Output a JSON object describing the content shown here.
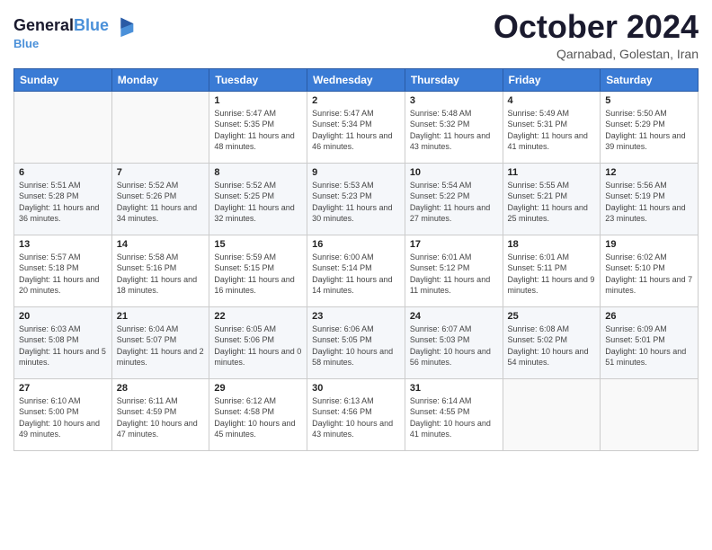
{
  "header": {
    "logo_line1": "General",
    "logo_line2": "Blue",
    "month_title": "October 2024",
    "location": "Qarnabad, Golestan, Iran"
  },
  "days_of_week": [
    "Sunday",
    "Monday",
    "Tuesday",
    "Wednesday",
    "Thursday",
    "Friday",
    "Saturday"
  ],
  "weeks": [
    [
      {
        "day": "",
        "sunrise": "",
        "sunset": "",
        "daylight": ""
      },
      {
        "day": "",
        "sunrise": "",
        "sunset": "",
        "daylight": ""
      },
      {
        "day": "1",
        "sunrise": "Sunrise: 5:47 AM",
        "sunset": "Sunset: 5:35 PM",
        "daylight": "Daylight: 11 hours and 48 minutes."
      },
      {
        "day": "2",
        "sunrise": "Sunrise: 5:47 AM",
        "sunset": "Sunset: 5:34 PM",
        "daylight": "Daylight: 11 hours and 46 minutes."
      },
      {
        "day": "3",
        "sunrise": "Sunrise: 5:48 AM",
        "sunset": "Sunset: 5:32 PM",
        "daylight": "Daylight: 11 hours and 43 minutes."
      },
      {
        "day": "4",
        "sunrise": "Sunrise: 5:49 AM",
        "sunset": "Sunset: 5:31 PM",
        "daylight": "Daylight: 11 hours and 41 minutes."
      },
      {
        "day": "5",
        "sunrise": "Sunrise: 5:50 AM",
        "sunset": "Sunset: 5:29 PM",
        "daylight": "Daylight: 11 hours and 39 minutes."
      }
    ],
    [
      {
        "day": "6",
        "sunrise": "Sunrise: 5:51 AM",
        "sunset": "Sunset: 5:28 PM",
        "daylight": "Daylight: 11 hours and 36 minutes."
      },
      {
        "day": "7",
        "sunrise": "Sunrise: 5:52 AM",
        "sunset": "Sunset: 5:26 PM",
        "daylight": "Daylight: 11 hours and 34 minutes."
      },
      {
        "day": "8",
        "sunrise": "Sunrise: 5:52 AM",
        "sunset": "Sunset: 5:25 PM",
        "daylight": "Daylight: 11 hours and 32 minutes."
      },
      {
        "day": "9",
        "sunrise": "Sunrise: 5:53 AM",
        "sunset": "Sunset: 5:23 PM",
        "daylight": "Daylight: 11 hours and 30 minutes."
      },
      {
        "day": "10",
        "sunrise": "Sunrise: 5:54 AM",
        "sunset": "Sunset: 5:22 PM",
        "daylight": "Daylight: 11 hours and 27 minutes."
      },
      {
        "day": "11",
        "sunrise": "Sunrise: 5:55 AM",
        "sunset": "Sunset: 5:21 PM",
        "daylight": "Daylight: 11 hours and 25 minutes."
      },
      {
        "day": "12",
        "sunrise": "Sunrise: 5:56 AM",
        "sunset": "Sunset: 5:19 PM",
        "daylight": "Daylight: 11 hours and 23 minutes."
      }
    ],
    [
      {
        "day": "13",
        "sunrise": "Sunrise: 5:57 AM",
        "sunset": "Sunset: 5:18 PM",
        "daylight": "Daylight: 11 hours and 20 minutes."
      },
      {
        "day": "14",
        "sunrise": "Sunrise: 5:58 AM",
        "sunset": "Sunset: 5:16 PM",
        "daylight": "Daylight: 11 hours and 18 minutes."
      },
      {
        "day": "15",
        "sunrise": "Sunrise: 5:59 AM",
        "sunset": "Sunset: 5:15 PM",
        "daylight": "Daylight: 11 hours and 16 minutes."
      },
      {
        "day": "16",
        "sunrise": "Sunrise: 6:00 AM",
        "sunset": "Sunset: 5:14 PM",
        "daylight": "Daylight: 11 hours and 14 minutes."
      },
      {
        "day": "17",
        "sunrise": "Sunrise: 6:01 AM",
        "sunset": "Sunset: 5:12 PM",
        "daylight": "Daylight: 11 hours and 11 minutes."
      },
      {
        "day": "18",
        "sunrise": "Sunrise: 6:01 AM",
        "sunset": "Sunset: 5:11 PM",
        "daylight": "Daylight: 11 hours and 9 minutes."
      },
      {
        "day": "19",
        "sunrise": "Sunrise: 6:02 AM",
        "sunset": "Sunset: 5:10 PM",
        "daylight": "Daylight: 11 hours and 7 minutes."
      }
    ],
    [
      {
        "day": "20",
        "sunrise": "Sunrise: 6:03 AM",
        "sunset": "Sunset: 5:08 PM",
        "daylight": "Daylight: 11 hours and 5 minutes."
      },
      {
        "day": "21",
        "sunrise": "Sunrise: 6:04 AM",
        "sunset": "Sunset: 5:07 PM",
        "daylight": "Daylight: 11 hours and 2 minutes."
      },
      {
        "day": "22",
        "sunrise": "Sunrise: 6:05 AM",
        "sunset": "Sunset: 5:06 PM",
        "daylight": "Daylight: 11 hours and 0 minutes."
      },
      {
        "day": "23",
        "sunrise": "Sunrise: 6:06 AM",
        "sunset": "Sunset: 5:05 PM",
        "daylight": "Daylight: 10 hours and 58 minutes."
      },
      {
        "day": "24",
        "sunrise": "Sunrise: 6:07 AM",
        "sunset": "Sunset: 5:03 PM",
        "daylight": "Daylight: 10 hours and 56 minutes."
      },
      {
        "day": "25",
        "sunrise": "Sunrise: 6:08 AM",
        "sunset": "Sunset: 5:02 PM",
        "daylight": "Daylight: 10 hours and 54 minutes."
      },
      {
        "day": "26",
        "sunrise": "Sunrise: 6:09 AM",
        "sunset": "Sunset: 5:01 PM",
        "daylight": "Daylight: 10 hours and 51 minutes."
      }
    ],
    [
      {
        "day": "27",
        "sunrise": "Sunrise: 6:10 AM",
        "sunset": "Sunset: 5:00 PM",
        "daylight": "Daylight: 10 hours and 49 minutes."
      },
      {
        "day": "28",
        "sunrise": "Sunrise: 6:11 AM",
        "sunset": "Sunset: 4:59 PM",
        "daylight": "Daylight: 10 hours and 47 minutes."
      },
      {
        "day": "29",
        "sunrise": "Sunrise: 6:12 AM",
        "sunset": "Sunset: 4:58 PM",
        "daylight": "Daylight: 10 hours and 45 minutes."
      },
      {
        "day": "30",
        "sunrise": "Sunrise: 6:13 AM",
        "sunset": "Sunset: 4:56 PM",
        "daylight": "Daylight: 10 hours and 43 minutes."
      },
      {
        "day": "31",
        "sunrise": "Sunrise: 6:14 AM",
        "sunset": "Sunset: 4:55 PM",
        "daylight": "Daylight: 10 hours and 41 minutes."
      },
      {
        "day": "",
        "sunrise": "",
        "sunset": "",
        "daylight": ""
      },
      {
        "day": "",
        "sunrise": "",
        "sunset": "",
        "daylight": ""
      }
    ]
  ]
}
